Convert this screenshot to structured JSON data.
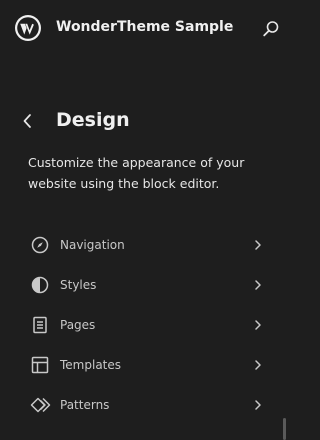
{
  "header": {
    "site_title": "WonderTheme Sample",
    "logo_icon": "wordpress-logo-icon",
    "search_icon": "search-icon"
  },
  "panel": {
    "title": "Design",
    "back_icon": "chevron-left-icon",
    "description": "Customize the appearance of your website using the block editor."
  },
  "nav": {
    "items": [
      {
        "label": "Navigation",
        "icon": "navigation-compass-icon"
      },
      {
        "label": "Styles",
        "icon": "styles-half-circle-icon"
      },
      {
        "label": "Pages",
        "icon": "pages-document-icon"
      },
      {
        "label": "Templates",
        "icon": "templates-layout-icon"
      },
      {
        "label": "Patterns",
        "icon": "patterns-diamond-icon"
      }
    ]
  },
  "colors": {
    "background": "#1e1e1e",
    "text": "#e0e0e0",
    "muted": "#c8c8c8"
  }
}
